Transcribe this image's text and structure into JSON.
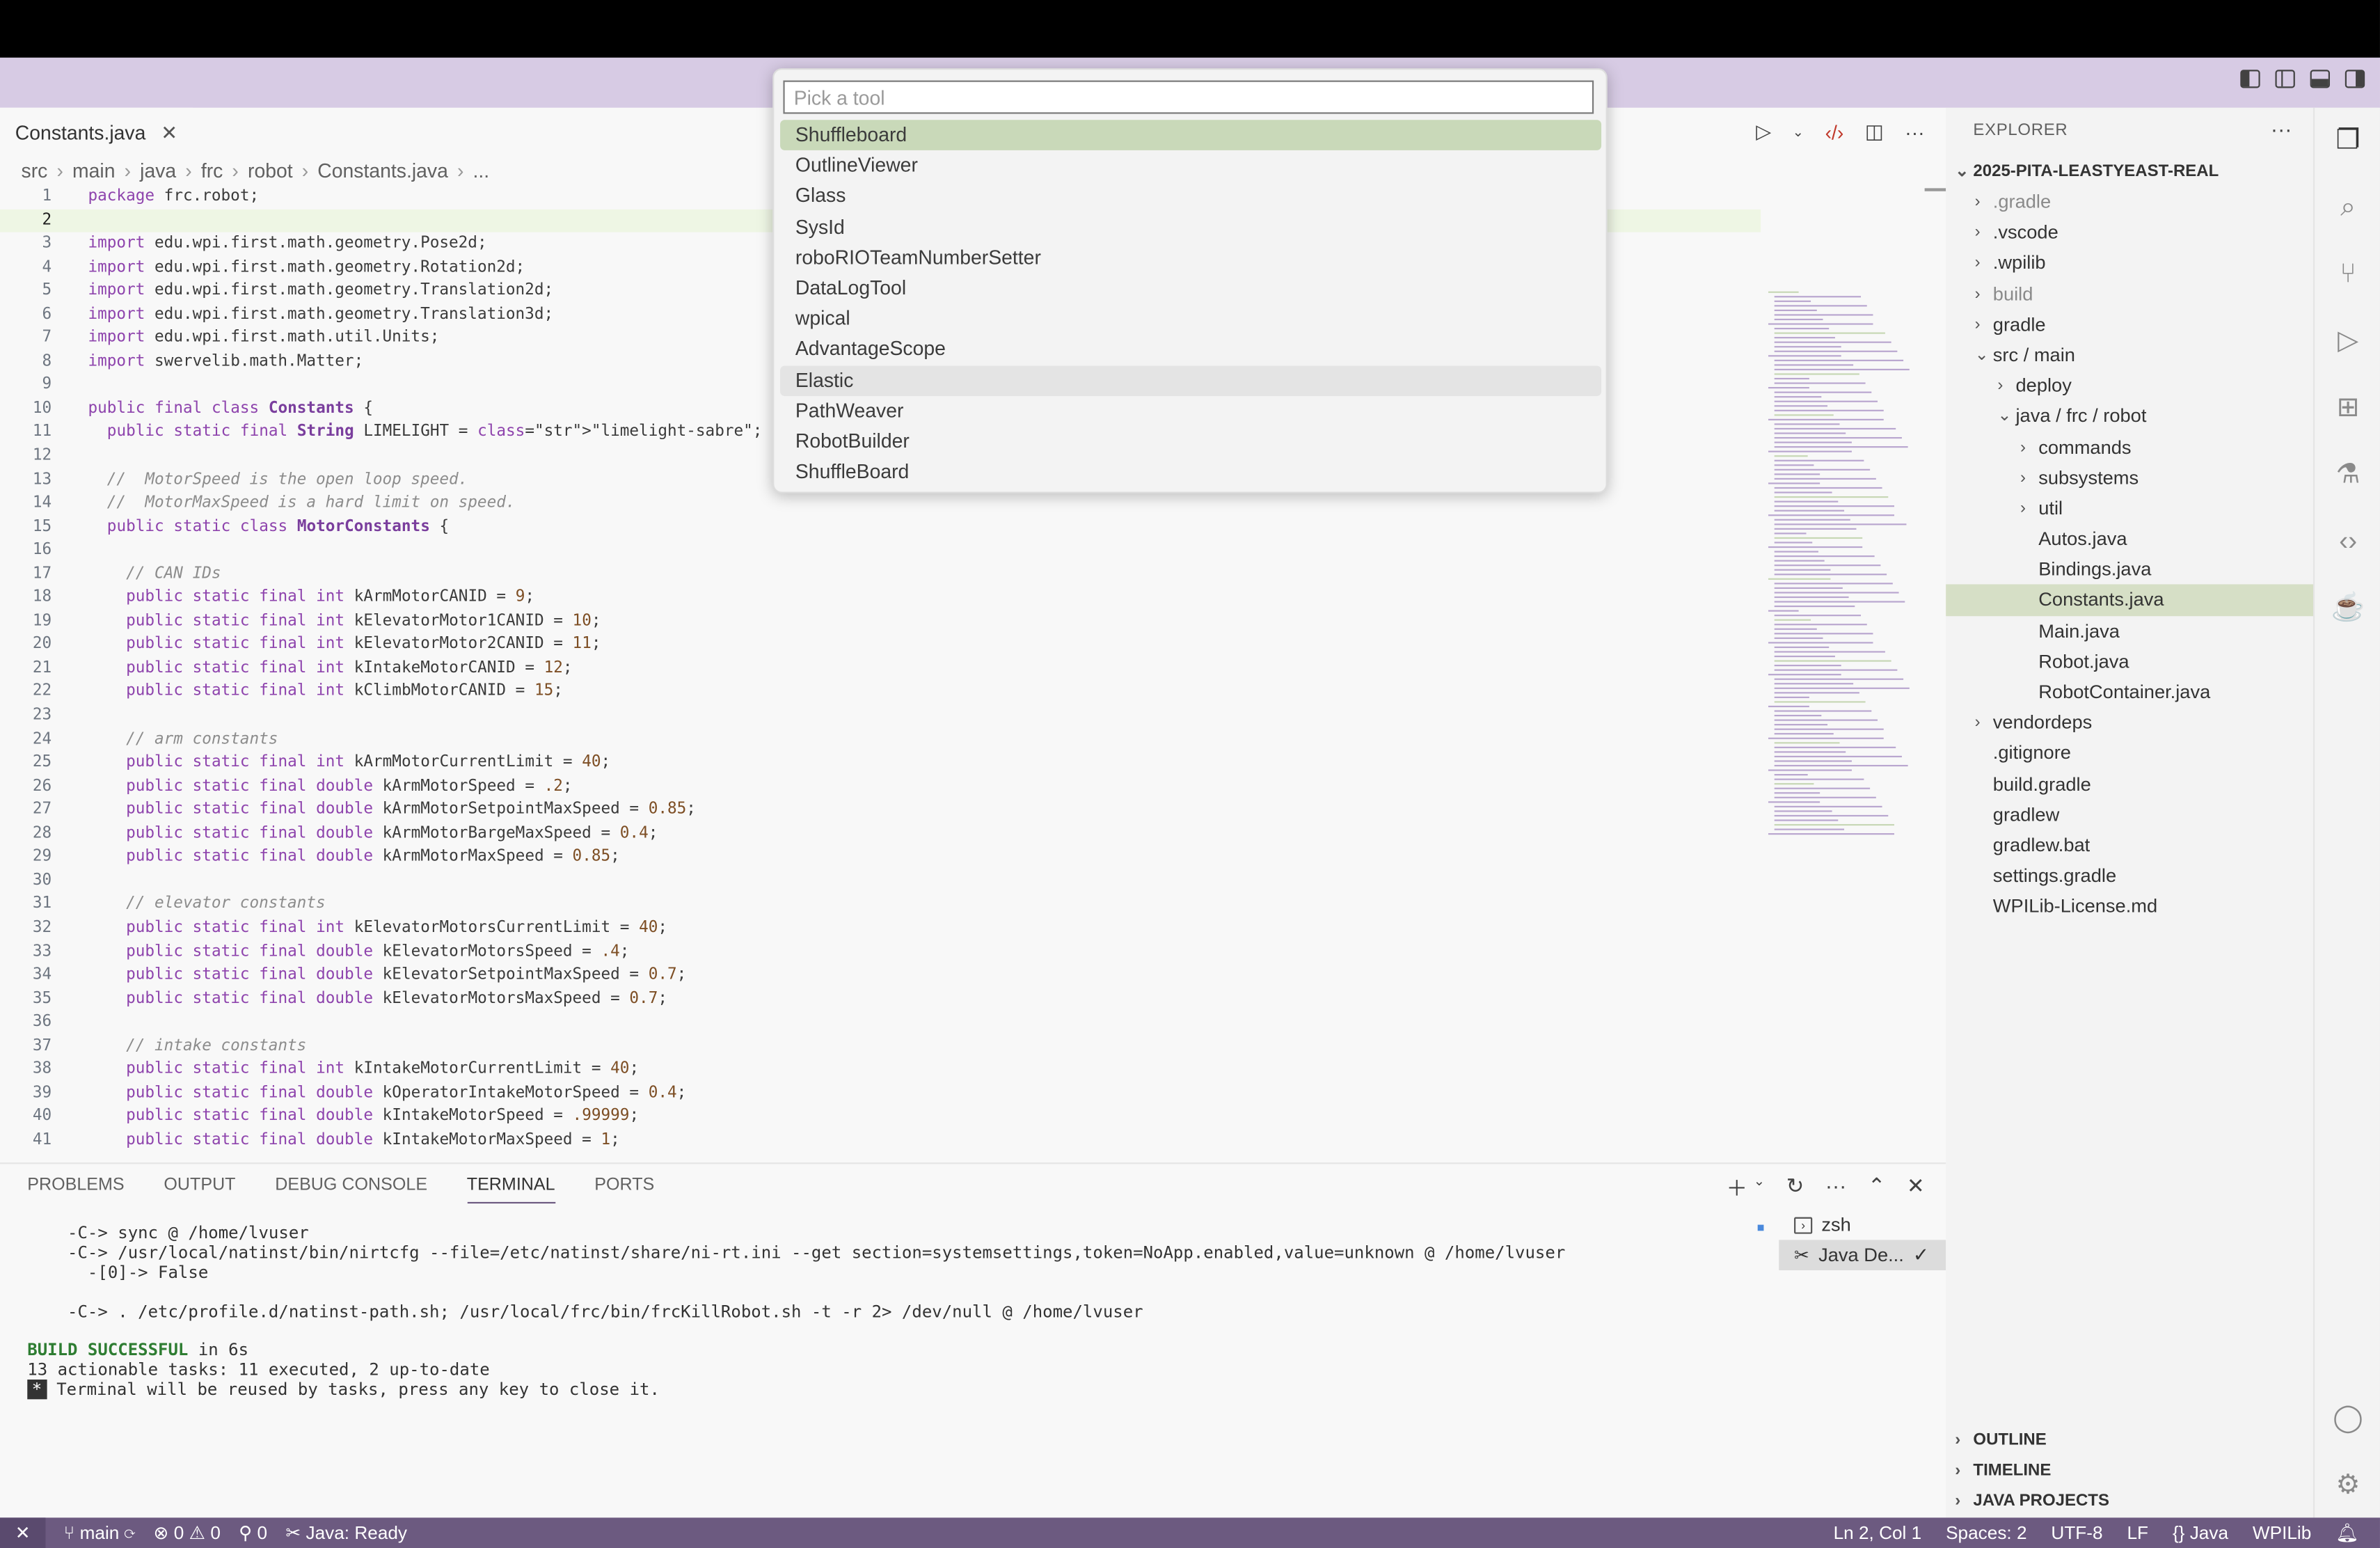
{
  "tab": {
    "filename": "Constants.java",
    "close": "✕"
  },
  "breadcrumb": [
    "src",
    "main",
    "java",
    "frc",
    "robot",
    "Constants.java",
    "..."
  ],
  "quickpick": {
    "placeholder": "Pick a tool",
    "items": [
      "Shuffleboard",
      "OutlineViewer",
      "Glass",
      "SysId",
      "roboRIOTeamNumberSetter",
      "DataLogTool",
      "wpical",
      "AdvantageScope",
      "Elastic",
      "PathWeaver",
      "RobotBuilder",
      "ShuffleBoard"
    ]
  },
  "code": [
    "package frc.robot;",
    "",
    "import edu.wpi.first.math.geometry.Pose2d;",
    "import edu.wpi.first.math.geometry.Rotation2d;",
    "import edu.wpi.first.math.geometry.Translation2d;",
    "import edu.wpi.first.math.geometry.Translation3d;",
    "import edu.wpi.first.math.util.Units;",
    "import swervelib.math.Matter;",
    "",
    "public final class Constants {",
    "  public static final String LIMELIGHT = \"limelight-sabre\";",
    "",
    "  //  MotorSpeed is the open loop speed.",
    "  //  MotorMaxSpeed is a hard limit on speed.",
    "  public static class MotorConstants {",
    "",
    "    // CAN IDs",
    "    public static final int kArmMotorCANID = 9;",
    "    public static final int kElevatorMotor1CANID = 10;",
    "    public static final int kElevatorMotor2CANID = 11;",
    "    public static final int kIntakeMotorCANID = 12;",
    "    public static final int kClimbMotorCANID = 15;",
    "",
    "    // arm constants",
    "    public static final int kArmMotorCurrentLimit = 40;",
    "    public static final double kArmMotorSpeed = .2;",
    "    public static final double kArmMotorSetpointMaxSpeed = 0.85;",
    "    public static final double kArmMotorBargeMaxSpeed = 0.4;",
    "    public static final double kArmMotorMaxSpeed = 0.85;",
    "",
    "    // elevator constants",
    "    public static final int kElevatorMotorsCurrentLimit = 40;",
    "    public static final double kElevatorMotorsSpeed = .4;",
    "    public static final double kElevatorSetpointMaxSpeed = 0.7;",
    "    public static final double kElevatorMotorsMaxSpeed = 0.7;",
    "",
    "    // intake constants",
    "    public static final int kIntakeMotorCurrentLimit = 40;",
    "    public static final double kOperatorIntakeMotorSpeed = 0.4;",
    "    public static final double kIntakeMotorSpeed = .99999;",
    "    public static final double kIntakeMotorMaxSpeed = 1;"
  ],
  "current_line": 2,
  "panel": {
    "tabs": [
      "PROBLEMS",
      "OUTPUT",
      "DEBUG CONSOLE",
      "TERMINAL",
      "PORTS"
    ],
    "active_tab": "TERMINAL",
    "terminal_lines": [
      "    -C-> sync @ /home/lvuser",
      "    -C-> /usr/local/natinst/bin/nirtcfg --file=/etc/natinst/share/ni-rt.ini --get section=systemsettings,token=NoApp.enabled,value=unknown @ /home/lvuser",
      "      -[0]-> False",
      "",
      "    -C-> . /etc/profile.d/natinst-path.sh; /usr/local/frc/bin/frcKillRobot.sh -t -r 2> /dev/null @ /home/lvuser",
      ""
    ],
    "build_success": "BUILD SUCCESSFUL",
    "build_time": " in 6s",
    "tasks_line": "13 actionable tasks: 11 executed, 2 up-to-date",
    "reuse_star": "*",
    "reuse_line": " Terminal will be reused by tasks, press any key to close it.",
    "terminals": [
      {
        "name": "zsh",
        "icon": "terminal-icon"
      },
      {
        "name": "Java De...",
        "icon": "tools-icon",
        "check": "✓"
      }
    ]
  },
  "explorer": {
    "header": "EXPLORER",
    "more": "···",
    "root": "2025-PITA-LEASTYEAST-REAL",
    "tree": [
      {
        "label": ".gradle",
        "depth": 0,
        "folder": true,
        "open": false,
        "dim": true
      },
      {
        "label": ".vscode",
        "depth": 0,
        "folder": true,
        "open": false
      },
      {
        "label": ".wpilib",
        "depth": 0,
        "folder": true,
        "open": false
      },
      {
        "label": "build",
        "depth": 0,
        "folder": true,
        "open": false,
        "dim": true
      },
      {
        "label": "gradle",
        "depth": 0,
        "folder": true,
        "open": false
      },
      {
        "label": "src / main",
        "depth": 0,
        "folder": true,
        "open": true
      },
      {
        "label": "deploy",
        "depth": 1,
        "folder": true,
        "open": false
      },
      {
        "label": "java / frc / robot",
        "depth": 1,
        "folder": true,
        "open": true
      },
      {
        "label": "commands",
        "depth": 2,
        "folder": true,
        "open": false
      },
      {
        "label": "subsystems",
        "depth": 2,
        "folder": true,
        "open": false
      },
      {
        "label": "util",
        "depth": 2,
        "folder": true,
        "open": false
      },
      {
        "label": "Autos.java",
        "depth": 2,
        "folder": false
      },
      {
        "label": "Bindings.java",
        "depth": 2,
        "folder": false
      },
      {
        "label": "Constants.java",
        "depth": 2,
        "folder": false,
        "selected": true
      },
      {
        "label": "Main.java",
        "depth": 2,
        "folder": false
      },
      {
        "label": "Robot.java",
        "depth": 2,
        "folder": false
      },
      {
        "label": "RobotContainer.java",
        "depth": 2,
        "folder": false
      },
      {
        "label": "vendordeps",
        "depth": 0,
        "folder": true,
        "open": false
      },
      {
        "label": ".gitignore",
        "depth": 0,
        "folder": false
      },
      {
        "label": "build.gradle",
        "depth": 0,
        "folder": false
      },
      {
        "label": "gradlew",
        "depth": 0,
        "folder": false
      },
      {
        "label": "gradlew.bat",
        "depth": 0,
        "folder": false
      },
      {
        "label": "settings.gradle",
        "depth": 0,
        "folder": false
      },
      {
        "label": "WPILib-License.md",
        "depth": 0,
        "folder": false
      }
    ],
    "sections": [
      "OUTLINE",
      "TIMELINE",
      "JAVA PROJECTS"
    ]
  },
  "status": {
    "branch": "main",
    "errors": "0",
    "warnings": "0",
    "ports": "0",
    "java": "Java: Ready",
    "position": "Ln 2, Col 1",
    "spaces": "Spaces: 2",
    "encoding": "UTF-8",
    "eol": "LF",
    "language": "Java",
    "wpilib": "WPILib"
  },
  "colors": {
    "titlebar": "#d7cbe4",
    "statusbar": "#6c5a80",
    "selection": "#c9d9b9"
  }
}
